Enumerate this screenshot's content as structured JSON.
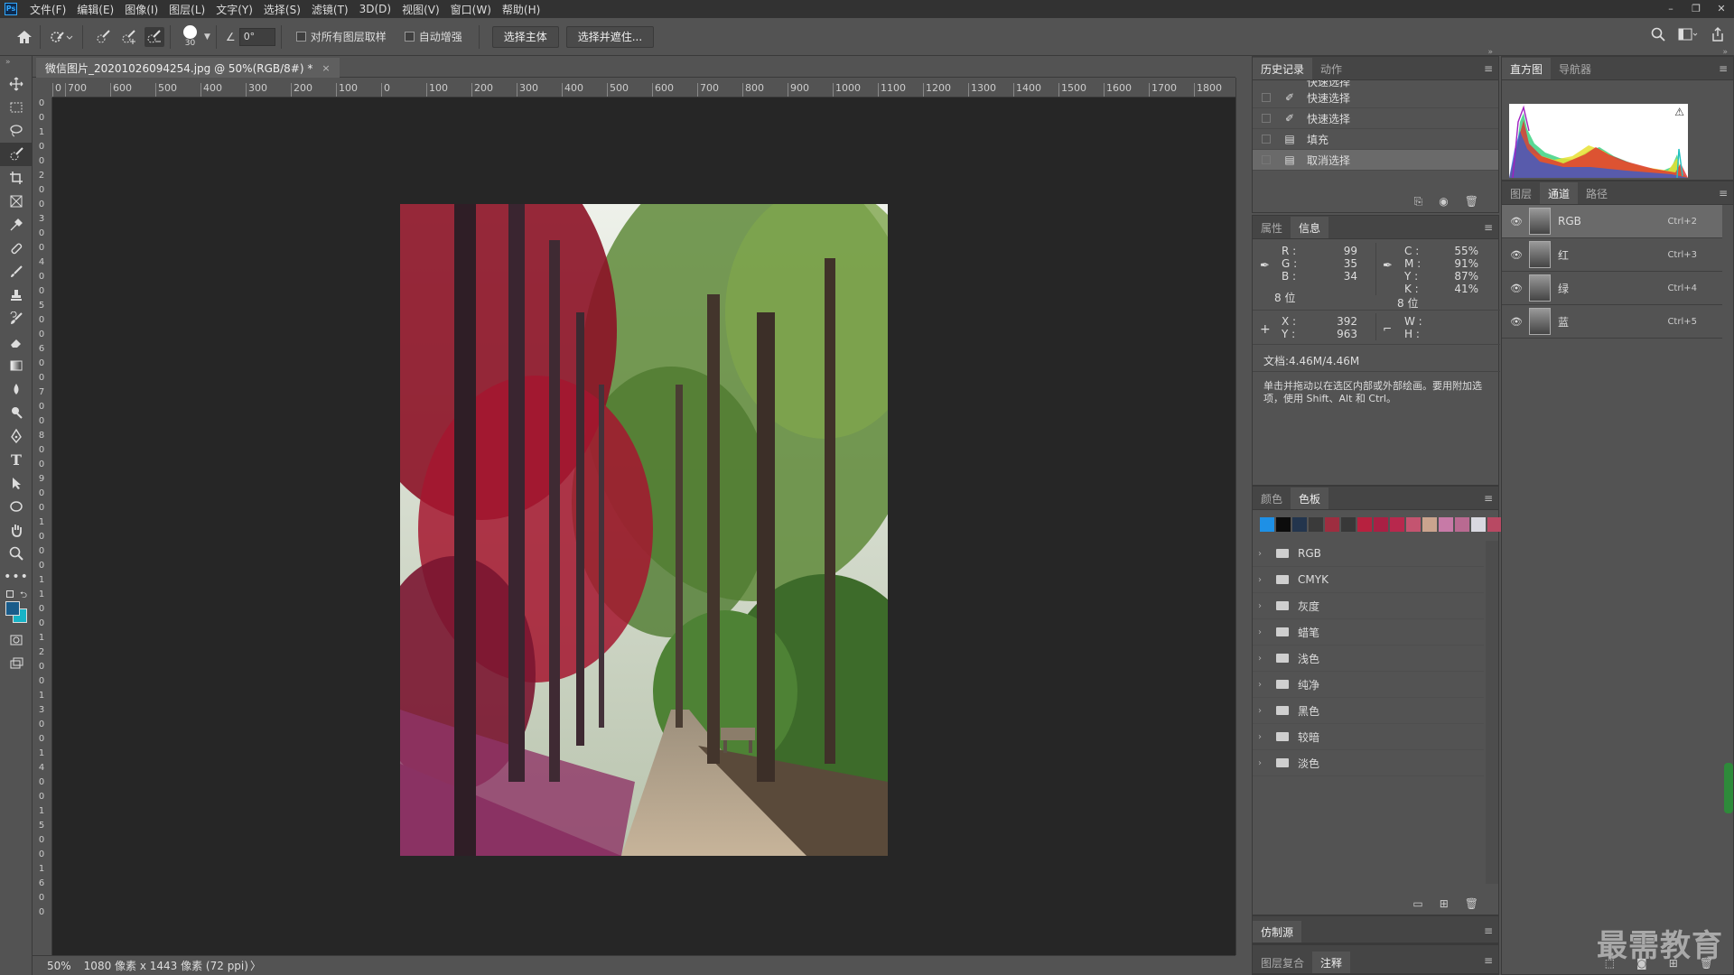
{
  "menubar": {
    "logo": "Ps",
    "items": [
      "文件(F)",
      "编辑(E)",
      "图像(I)",
      "图层(L)",
      "文字(Y)",
      "选择(S)",
      "滤镜(T)",
      "3D(D)",
      "视图(V)",
      "窗口(W)",
      "帮助(H)"
    ],
    "window_buttons": [
      "–",
      "❐",
      "✕"
    ]
  },
  "options": {
    "brush_size": "30",
    "angle": "0°",
    "sample_all_label": "对所有图层取样",
    "auto_enhance_label": "自动增强",
    "select_subject": "选择主体",
    "select_mask": "选择并遮住..."
  },
  "document": {
    "tab_title": "微信图片_20201026094254.jpg @ 50%(RGB/8#) *",
    "close": "×"
  },
  "ruler": {
    "h_labels": [
      "0",
      "700",
      "600",
      "500",
      "400",
      "300",
      "200",
      "100",
      "0",
      "100",
      "200",
      "300",
      "400",
      "500",
      "600",
      "700",
      "800",
      "900",
      "1000",
      "1100",
      "1200",
      "1300",
      "1400",
      "1500",
      "1600",
      "1700",
      "1800"
    ],
    "v_labels": [
      "0",
      "0",
      "1",
      "0",
      "0",
      "2",
      "0",
      "0",
      "3",
      "0",
      "0",
      "4",
      "0",
      "0",
      "5",
      "0",
      "0",
      "6",
      "0",
      "0",
      "7",
      "0",
      "0",
      "8",
      "0",
      "0",
      "9",
      "0",
      "0",
      "1",
      "0",
      "0",
      "0",
      "1",
      "1",
      "0",
      "0",
      "1",
      "2",
      "0",
      "0",
      "1",
      "3",
      "0",
      "0",
      "1",
      "4",
      "0",
      "0",
      "1",
      "5",
      "0",
      "0",
      "1",
      "6",
      "0",
      "0"
    ]
  },
  "status": {
    "zoom": "50%",
    "doc_size": "1080 像素 x 1443 像素 (72 ppi)",
    "arrow": "〉"
  },
  "history": {
    "tabs": [
      "历史记录",
      "动作"
    ],
    "items": [
      {
        "label": "快速选择",
        "selected": false,
        "icon": "brush-icon"
      },
      {
        "label": "快速选择",
        "selected": false,
        "icon": "brush-icon"
      },
      {
        "label": "快速选择",
        "selected": false,
        "icon": "brush-icon"
      },
      {
        "label": "填充",
        "selected": false,
        "icon": "doc-icon"
      },
      {
        "label": "取消选择",
        "selected": true,
        "icon": "doc-icon"
      }
    ]
  },
  "info": {
    "tabs": [
      "属性",
      "信息"
    ],
    "r_label": "R :",
    "r": "99",
    "g_label": "G :",
    "g": "35",
    "b_label": "B :",
    "b": "34",
    "bits_left": "8 位",
    "c_label": "C :",
    "c": "55%",
    "m_label": "M :",
    "m": "91%",
    "y_label": "Y :",
    "y": "87%",
    "k_label": "K :",
    "k": "41%",
    "bits_right": "8 位",
    "x_label": "X :",
    "x": "392",
    "yy_label": "Y :",
    "yy": "963",
    "w_label": "W :",
    "h_label": "H :",
    "doc": "文档:4.46M/4.46M",
    "hint": "单击并拖动以在选区内部或外部绘画。要用附加选项，使用 Shift、Alt 和 Ctrl。"
  },
  "swatches": {
    "tabs": [
      "颜色",
      "色板"
    ],
    "colors": [
      "#1e90e6",
      "#0c0c0c",
      "#23354d",
      "#3a3a3a",
      "#9e2d40",
      "#383838",
      "#b7213f",
      "#a92044",
      "#b8284d",
      "#c45470",
      "#caa48e",
      "#c77aa7",
      "#b96a91",
      "#d8d8e0",
      "#b84963"
    ],
    "folders": [
      "RGB",
      "CMYK",
      "灰度",
      "蜡笔",
      "浅色",
      "纯净",
      "黑色",
      "较暗",
      "淡色"
    ]
  },
  "clone": {
    "title": "仿制源"
  },
  "comps": {
    "tabs": [
      "图层复合",
      "注释"
    ]
  },
  "histogram": {
    "tabs": [
      "直方图",
      "导航器"
    ],
    "warn": "⚠"
  },
  "channels": {
    "tabs": [
      "图层",
      "通道",
      "路径"
    ],
    "items": [
      {
        "name": "RGB",
        "shortcut": "Ctrl+2",
        "selected": true
      },
      {
        "name": "红",
        "shortcut": "Ctrl+3",
        "selected": false
      },
      {
        "name": "绿",
        "shortcut": "Ctrl+4",
        "selected": false
      },
      {
        "name": "蓝",
        "shortcut": "Ctrl+5",
        "selected": false
      }
    ]
  },
  "watermark": "最需教育",
  "colors": {
    "fg": "#1a5c8a",
    "bg": "#16b3c6",
    "accent": "#31a8ff"
  }
}
